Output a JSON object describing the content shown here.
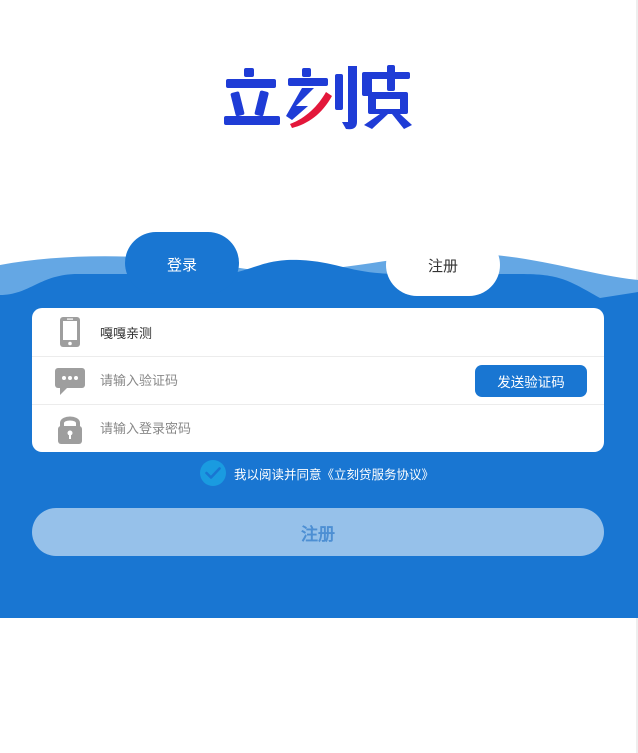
{
  "logo": {
    "alt": "立刻贷"
  },
  "tabs": {
    "login_label": "登录",
    "register_label": "注册"
  },
  "form": {
    "phone": {
      "value": "嘎嘎亲测",
      "icon": "phone-icon"
    },
    "sms_code": {
      "placeholder": "请输入验证码",
      "icon": "message-icon",
      "send_button_label": "发送验证码"
    },
    "password": {
      "placeholder": "请输入登录密码",
      "icon": "lock-icon"
    }
  },
  "agreement": {
    "checked": true,
    "text": "我以阅读并同意《立刻贷服务协议》"
  },
  "submit": {
    "label": "注册"
  },
  "colors": {
    "primary_blue": "#1976d2",
    "light_wave": "#64a7e4",
    "submit_bg": "#96c1ea",
    "check_bg": "#1a9be0",
    "logo_blue": "#1f3cd6",
    "logo_red": "#e3173a"
  }
}
